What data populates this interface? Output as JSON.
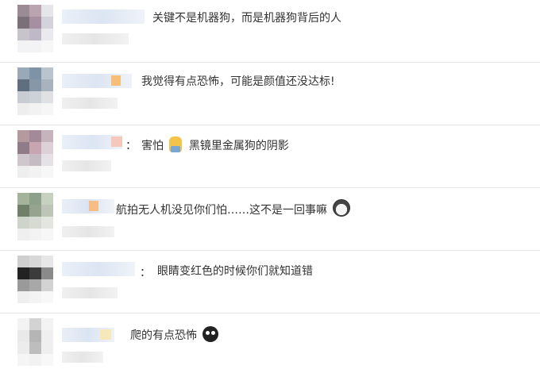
{
  "comments": [
    {
      "text": "关键不是机器狗，而是机器狗背后的人"
    },
    {
      "text": "我觉得有点恐怖，可能是颜值还没达标!"
    },
    {
      "text": "害怕",
      "after_emoji_text": "黑镜里金属狗的阴影",
      "emoji": "scared-face-icon"
    },
    {
      "text": "航拍无人机没见你们怕……这不是一回事嘛",
      "emoji": "husky-dog-icon"
    },
    {
      "text": "眼睛变红色的时候你们就知道错"
    },
    {
      "text": "爬的有点恐怖",
      "emoji": "crying-face-icon"
    }
  ],
  "separator": "：",
  "colors": {
    "text": "#333333",
    "divider": "#e6e6e6"
  }
}
